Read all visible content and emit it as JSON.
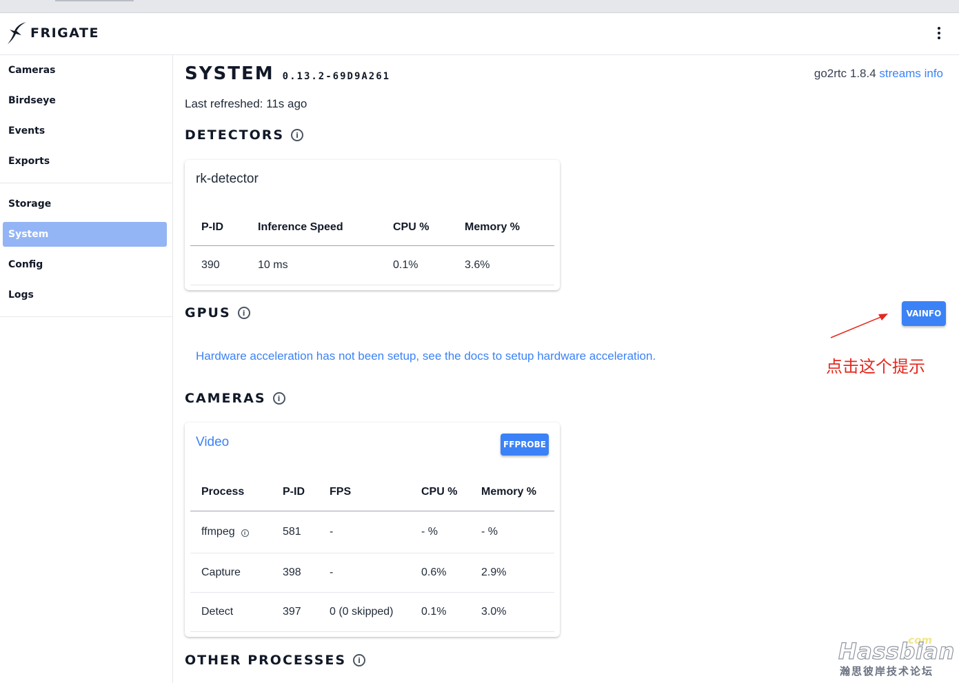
{
  "app": {
    "name": "FRIGATE"
  },
  "sidebar": {
    "groups": [
      {
        "items": [
          {
            "label": "Cameras"
          },
          {
            "label": "Birdseye"
          },
          {
            "label": "Events"
          },
          {
            "label": "Exports"
          }
        ]
      },
      {
        "items": [
          {
            "label": "Storage"
          },
          {
            "label": "System",
            "active": true
          },
          {
            "label": "Config"
          },
          {
            "label": "Logs"
          }
        ]
      }
    ]
  },
  "page": {
    "title": "SYSTEM",
    "version": "0.13.2-69D9A261",
    "go2rtc_label": "go2rtc 1.8.4",
    "streams_info_link": "streams info",
    "last_refreshed": "Last refreshed: 11s ago"
  },
  "detectors": {
    "heading": "DETECTORS",
    "card_title": "rk-detector",
    "columns": [
      "P-ID",
      "Inference Speed",
      "CPU %",
      "Memory %"
    ],
    "rows": [
      [
        "390",
        "10 ms",
        "0.1%",
        "3.6%"
      ]
    ]
  },
  "gpus": {
    "heading": "GPUS",
    "vainfo_button": "VAINFO",
    "message": "Hardware acceleration has not been setup, see the docs to setup hardware acceleration."
  },
  "cameras": {
    "heading": "CAMERAS",
    "card_title": "Video",
    "ffprobe_button": "FFPROBE",
    "columns": [
      "Process",
      "P-ID",
      "FPS",
      "CPU %",
      "Memory %"
    ],
    "rows": [
      [
        "ffmpeg",
        "581",
        "-",
        "- %",
        "- %"
      ],
      [
        "Capture",
        "398",
        "-",
        "0.6%",
        "2.9%"
      ],
      [
        "Detect",
        "397",
        "0 (0 skipped)",
        "0.1%",
        "3.0%"
      ]
    ]
  },
  "other_processes": {
    "heading": "OTHER PROCESSES"
  },
  "annotation": {
    "text": "点击这个提示",
    "color": "#e5281e"
  },
  "watermark": {
    "com": "com",
    "main": "Hassbian",
    "sub": "瀚思彼岸技术论坛"
  },
  "colors": {
    "accent": "#3b82f6",
    "active_nav": "#93b5f5"
  }
}
